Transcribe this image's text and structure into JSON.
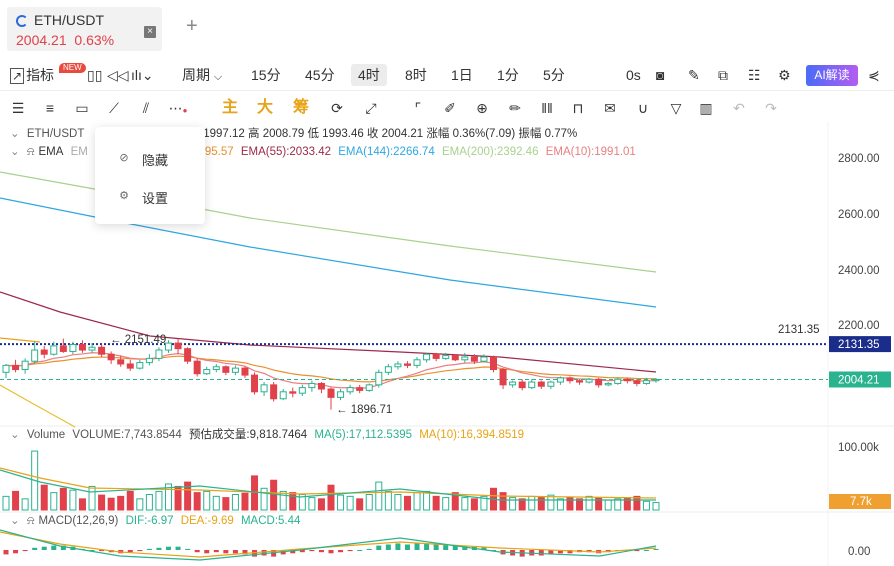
{
  "tab": {
    "title": "ETH/USDT",
    "price": "2004.21",
    "change": "0.63%",
    "close_icon": "close-icon",
    "add_icon": "plus-icon"
  },
  "periodbar": {
    "indicator_label": "指标",
    "new_badge": "NEW",
    "period_label": "周期",
    "periods": [
      "15分",
      "45分",
      "4时",
      "8时",
      "1日",
      "1分",
      "5分"
    ],
    "active_period": "4时",
    "replay": "0s",
    "ai_label": "AI解读"
  },
  "drawbar": {
    "main_label": "主",
    "big_label": "大",
    "chip_label": "筹"
  },
  "legend": {
    "symbol": "ETH/USDT",
    "ohlc_text": "下1997.12  高 2008.79  低 1993.46  收 2004.21  涨幅 0.36%(7.09)  振幅 0.77%",
    "ema_label": "EMA",
    "ema_prefix": "EM",
    "ema21": "21):1995.57",
    "ema55": "EMA(55):2033.42",
    "ema144": "EMA(144):2266.74",
    "ema200": "EMA(200):2392.46",
    "ema10": "EMA(10):1991.01",
    "volume_title": "Volume",
    "volume_value": "VOLUME:7,743.8544",
    "volume_est": "预估成交量:9,818.7464",
    "ma5": "MA(5):17,112.5395",
    "ma10": "MA(10):16,394.8519",
    "macd_title": "MACD(12,26,9)",
    "dif": "DIF:-6.97",
    "dea": "DEA:-9.69",
    "macd": "MACD:5.44"
  },
  "axis": {
    "price_ticks": [
      "2800.00",
      "2600.00",
      "2400.00",
      "2200.00"
    ],
    "hline_label": "2131.35",
    "current_price": "2004.21",
    "volume_tick": "100.00k",
    "volume_current": "7.7k",
    "macd_tick": "0.00"
  },
  "annotations": {
    "high_label": "← 2151.49",
    "low_label": "← 1896.71"
  },
  "context_menu": {
    "hide_label": "隐藏",
    "settings_label": "设置"
  },
  "colors": {
    "up": "#2ab38f",
    "down": "#e0414a",
    "ema144": "#2ea7e0",
    "ema200": "#a9d18e",
    "ema55": "#9c2a4a",
    "ema10": "#e88080",
    "ema21": "#e89030",
    "accent": "#2b6bd8"
  },
  "chart_data": {
    "type": "candlestick",
    "price_range": [
      1850,
      2900
    ],
    "hline": 2131.35,
    "current": 2004.21,
    "high_mark": 2151.49,
    "low_mark": 1896.71,
    "candles": [
      [
        2030,
        2055,
        2010,
        2060
      ],
      [
        2055,
        2040,
        2030,
        2075
      ],
      [
        2040,
        2070,
        2025,
        2080
      ],
      [
        2070,
        2110,
        2060,
        2140
      ],
      [
        2110,
        2095,
        2080,
        2125
      ],
      [
        2095,
        2125,
        2090,
        2140
      ],
      [
        2125,
        2105,
        2100,
        2151
      ],
      [
        2105,
        2130,
        2095,
        2140
      ],
      [
        2130,
        2110,
        2100,
        2145
      ],
      [
        2110,
        2120,
        2100,
        2135
      ],
      [
        2120,
        2095,
        2085,
        2130
      ],
      [
        2095,
        2075,
        2060,
        2105
      ],
      [
        2075,
        2060,
        2050,
        2090
      ],
      [
        2060,
        2045,
        2035,
        2075
      ],
      [
        2045,
        2065,
        2040,
        2075
      ],
      [
        2065,
        2080,
        2055,
        2095
      ],
      [
        2080,
        2110,
        2070,
        2120
      ],
      [
        2110,
        2135,
        2100,
        2145
      ],
      [
        2135,
        2115,
        2095,
        2150
      ],
      [
        2115,
        2070,
        2060,
        2120
      ],
      [
        2070,
        2025,
        2015,
        2080
      ],
      [
        2025,
        2040,
        2020,
        2050
      ],
      [
        2040,
        2050,
        2030,
        2060
      ],
      [
        2050,
        2030,
        2020,
        2055
      ],
      [
        2030,
        2045,
        2020,
        2055
      ],
      [
        2045,
        2020,
        2010,
        2050
      ],
      [
        2020,
        1960,
        1950,
        2030
      ],
      [
        1960,
        1985,
        1945,
        1995
      ],
      [
        1985,
        1935,
        1925,
        1995
      ],
      [
        1935,
        1960,
        1930,
        1970
      ],
      [
        1960,
        1955,
        1940,
        1975
      ],
      [
        1955,
        1975,
        1945,
        1985
      ],
      [
        1975,
        1990,
        1960,
        2000
      ],
      [
        1990,
        1970,
        1955,
        1995
      ],
      [
        1970,
        1940,
        1896,
        1975
      ],
      [
        1940,
        1960,
        1930,
        1970
      ],
      [
        1960,
        1975,
        1950,
        1985
      ],
      [
        1975,
        1965,
        1955,
        1985
      ],
      [
        1965,
        1985,
        1960,
        1990
      ],
      [
        1985,
        2030,
        1975,
        2040
      ],
      [
        2030,
        2050,
        2020,
        2060
      ],
      [
        2050,
        2060,
        2040,
        2070
      ],
      [
        2060,
        2055,
        2045,
        2070
      ],
      [
        2055,
        2075,
        2045,
        2085
      ],
      [
        2075,
        2095,
        2065,
        2100
      ],
      [
        2095,
        2080,
        2070,
        2100
      ],
      [
        2080,
        2090,
        2075,
        2100
      ],
      [
        2090,
        2075,
        2070,
        2095
      ],
      [
        2075,
        2085,
        2065,
        2100
      ],
      [
        2085,
        2070,
        2060,
        2095
      ],
      [
        2070,
        2085,
        2065,
        2095
      ],
      [
        2085,
        2040,
        2030,
        2090
      ],
      [
        2040,
        1985,
        1970,
        2045
      ],
      [
        1985,
        1995,
        1975,
        2000
      ],
      [
        1995,
        1975,
        1965,
        2005
      ],
      [
        1975,
        1995,
        1970,
        2005
      ],
      [
        1995,
        1980,
        1970,
        2000
      ],
      [
        1980,
        1995,
        1970,
        2000
      ],
      [
        1995,
        2010,
        1985,
        2015
      ],
      [
        2010,
        2000,
        1990,
        2015
      ],
      [
        2000,
        1995,
        1985,
        2005
      ],
      [
        1995,
        2005,
        1990,
        2010
      ],
      [
        2005,
        1985,
        1975,
        2010
      ],
      [
        1985,
        1990,
        1980,
        1995
      ],
      [
        1990,
        2005,
        1985,
        2010
      ],
      [
        2005,
        2000,
        1990,
        2010
      ],
      [
        2000,
        1990,
        1980,
        2005
      ],
      [
        1990,
        2000,
        1985,
        2010
      ],
      [
        2000,
        2004,
        1993,
        2009
      ]
    ],
    "volumes": [
      22,
      30,
      18,
      95,
      40,
      28,
      35,
      32,
      18,
      38,
      24,
      19,
      22,
      30,
      18,
      25,
      30,
      42,
      38,
      45,
      28,
      30,
      22,
      20,
      25,
      27,
      55,
      35,
      48,
      30,
      28,
      25,
      20,
      18,
      40,
      24,
      22,
      18,
      25,
      45,
      30,
      25,
      22,
      28,
      30,
      22,
      20,
      28,
      20,
      18,
      22,
      35,
      28,
      20,
      18,
      22,
      20,
      24,
      18,
      20,
      18,
      22,
      20,
      16,
      18,
      20,
      22,
      14,
      12
    ],
    "macd": [
      -4,
      -3,
      -1,
      2,
      3,
      4,
      4,
      3,
      1,
      0,
      -1,
      -2,
      -3,
      -2,
      -1,
      1,
      2,
      3,
      3,
      1,
      -2,
      -3,
      -2,
      -3,
      -3,
      -4,
      -6,
      -5,
      -6,
      -4,
      -3,
      -2,
      -1,
      -2,
      -3,
      -2,
      -1,
      0,
      1,
      4,
      5,
      6,
      5,
      6,
      6,
      5,
      5,
      4,
      4,
      3,
      3,
      0,
      -4,
      -5,
      -6,
      -5,
      -5,
      -4,
      -3,
      -3,
      -2,
      -2,
      -3,
      -2,
      -1,
      -1,
      -1,
      0,
      1
    ]
  }
}
